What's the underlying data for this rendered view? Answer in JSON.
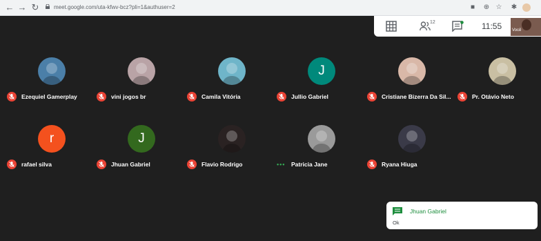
{
  "browser": {
    "url": "meet.google.com/uta-kfwv-bcz?pli=1&authuser=2",
    "icons": [
      "back-icon",
      "forward-icon",
      "reload-icon",
      "lock-icon",
      "camera-icon",
      "zoom-icon",
      "star-icon",
      "extensions-icon",
      "profile-icon"
    ]
  },
  "meet_bar": {
    "participant_count": "12",
    "time": "11:55",
    "self_label": "Você"
  },
  "participants": [
    {
      "name": "Ezequiel Gamerplay",
      "muted": true,
      "avatar_type": "photo",
      "avatar_color": "#4b7fa8"
    },
    {
      "name": "vini jogos br",
      "muted": true,
      "avatar_type": "photo",
      "avatar_color": "#b9a3a6"
    },
    {
      "name": "Camila Vitória",
      "muted": true,
      "avatar_type": "photo",
      "avatar_color": "#6fb5c9"
    },
    {
      "name": "Jullio Gabriel",
      "muted": true,
      "avatar_type": "initial",
      "initial": "J",
      "avatar_color": "#00897b"
    },
    {
      "name": "Cristiane Bizerra Da Sil...",
      "muted": true,
      "avatar_type": "photo",
      "avatar_color": "#d9b8a8"
    },
    {
      "name": "Pr. Otávio Neto",
      "muted": true,
      "avatar_type": "photo",
      "avatar_color": "#c9bfa3"
    },
    {
      "name": "rafael silva",
      "muted": true,
      "avatar_type": "initial",
      "initial": "r",
      "avatar_color": "#f4511e"
    },
    {
      "name": "Jhuan Gabriel",
      "muted": true,
      "avatar_type": "initial",
      "initial": "J",
      "avatar_color": "#33691e"
    },
    {
      "name": "Flavio Rodrigo",
      "muted": true,
      "avatar_type": "photo",
      "avatar_color": "#2a2222"
    },
    {
      "name": "Patricia Jane",
      "muted": false,
      "avatar_type": "photo",
      "avatar_color": "#9a9a9a"
    },
    {
      "name": "Ryana Hiuga",
      "muted": true,
      "avatar_type": "photo",
      "avatar_color": "#3a3a48"
    }
  ],
  "toast": {
    "sender": "Jhuan Gabriel",
    "message": "Ok"
  },
  "colors": {
    "stage": "#1f1f1f",
    "muted_badge": "#ea4335",
    "speaking_dots": "#34a853",
    "chat_green": "#1e8e3e"
  }
}
